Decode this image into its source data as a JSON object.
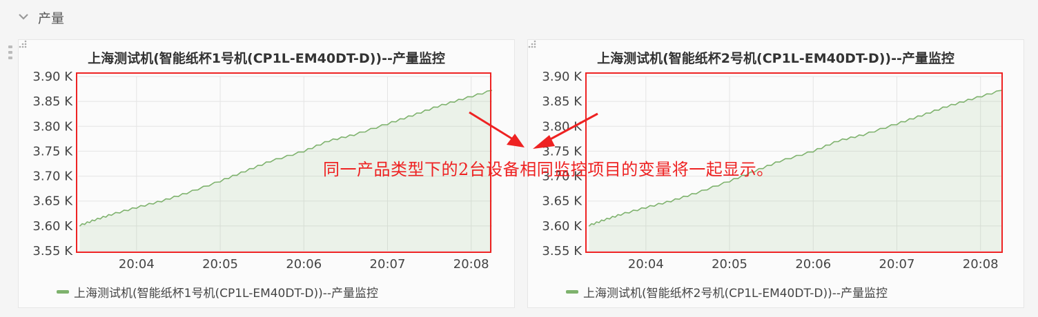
{
  "row": {
    "title": "产量",
    "chevron_icon": "chevron-down-icon",
    "drag_icon": "drag-handle-icon"
  },
  "annotation": {
    "text": "同一产品类型下的2台设备相同监控项目的变量将一起显示。",
    "color": "#ee2222"
  },
  "colors": {
    "series": "#7eb26d",
    "fill": "rgba(126,178,109,0.12)",
    "highlight_box": "#ee2222"
  },
  "panels": [
    {
      "title": "上海测试机(智能纸杯1号机(CP1L-EM40DT-D))--产量监控",
      "legend": "上海测试机(智能纸杯1号机(CP1L-EM40DT-D))--产量监控",
      "resize_icon": "resize-grip-icon"
    },
    {
      "title": "上海测试机(智能纸杯2号机(CP1L-EM40DT-D))--产量监控",
      "legend": "上海测试机(智能纸杯2号机(CP1L-EM40DT-D))--产量监控",
      "resize_icon": "resize-grip-icon"
    }
  ],
  "chart_data": [
    {
      "type": "area",
      "title": "上海测试机(智能纸杯1号机(CP1L-EM40DT-D))--产量监控",
      "x_ticks": [
        "20:04",
        "20:05",
        "20:06",
        "20:07",
        "20:08"
      ],
      "y_ticks": [
        "3.55 K",
        "3.60 K",
        "3.65 K",
        "3.70 K",
        "3.75 K",
        "3.80 K",
        "3.85 K",
        "3.90 K"
      ],
      "x_range_min": [
        3.3,
        8.25
      ],
      "ylim": [
        3550,
        3900
      ],
      "grid": true,
      "legend_position": "bottom-left",
      "series": [
        {
          "name": "上海测试机(智能纸杯1号机(CP1L-EM40DT-D))--产量监控",
          "x_min": [
            3.32,
            3.5,
            3.7,
            4.0,
            4.3,
            4.6,
            5.0,
            5.3,
            5.6,
            6.0,
            6.3,
            6.6,
            7.0,
            7.3,
            7.6,
            7.9,
            8.25
          ],
          "y": [
            3601,
            3612,
            3623,
            3637,
            3650,
            3666,
            3690,
            3710,
            3730,
            3750,
            3771,
            3783,
            3805,
            3822,
            3840,
            3855,
            3872
          ]
        }
      ]
    },
    {
      "type": "area",
      "title": "上海测试机(智能纸杯2号机(CP1L-EM40DT-D))--产量监控",
      "x_ticks": [
        "20:04",
        "20:05",
        "20:06",
        "20:07",
        "20:08"
      ],
      "y_ticks": [
        "3.55 K",
        "3.60 K",
        "3.65 K",
        "3.70 K",
        "3.75 K",
        "3.80 K",
        "3.85 K",
        "3.90 K"
      ],
      "x_range_min": [
        3.3,
        8.25
      ],
      "ylim": [
        3550,
        3900
      ],
      "grid": true,
      "legend_position": "bottom-left",
      "series": [
        {
          "name": "上海测试机(智能纸杯2号机(CP1L-EM40DT-D))--产量监控",
          "x_min": [
            3.32,
            3.5,
            3.7,
            4.0,
            4.3,
            4.6,
            5.0,
            5.3,
            5.6,
            6.0,
            6.3,
            6.6,
            7.0,
            7.3,
            7.6,
            7.9,
            8.25
          ],
          "y": [
            3601,
            3612,
            3623,
            3637,
            3650,
            3666,
            3690,
            3710,
            3730,
            3750,
            3771,
            3783,
            3805,
            3822,
            3840,
            3855,
            3872
          ]
        }
      ]
    }
  ]
}
